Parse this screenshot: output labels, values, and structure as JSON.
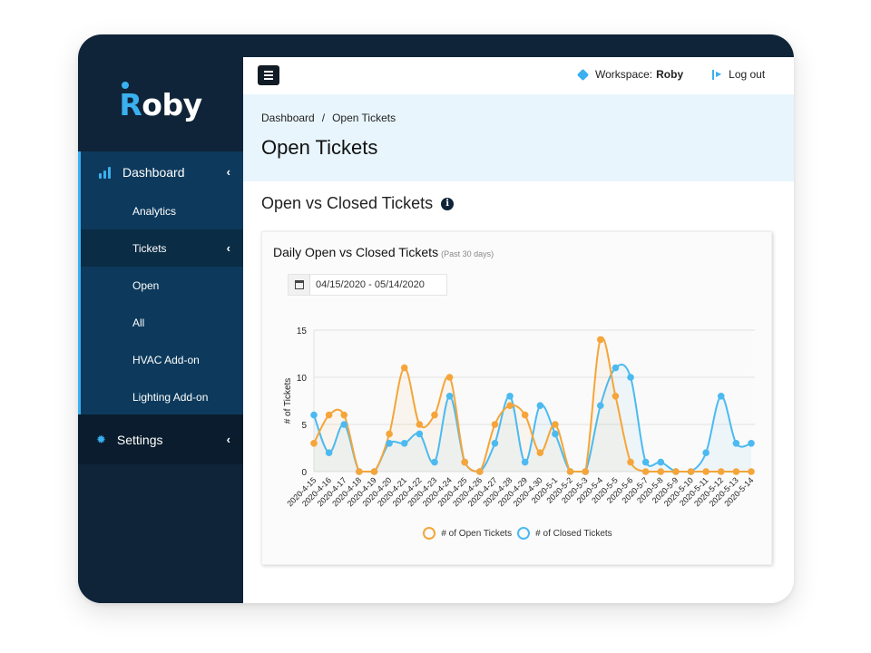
{
  "app": {
    "logo_text_r": "R",
    "logo_text_rest": "oby"
  },
  "sidebar": {
    "items": [
      {
        "label": "Dashboard",
        "icon": "bar-chart-icon",
        "expanded": true
      },
      {
        "label": "Analytics"
      },
      {
        "label": "Tickets",
        "active": true
      },
      {
        "label": "Open"
      },
      {
        "label": "All"
      },
      {
        "label": "HVAC Add-on"
      },
      {
        "label": "Lighting Add-on"
      },
      {
        "label": "Settings",
        "icon": "gear-icon"
      }
    ],
    "chevron": "‹"
  },
  "topnav": {
    "menu_icon": "hamburger-icon",
    "workspace_label": "Workspace:",
    "workspace_name": "Roby",
    "logout_label": "Log out"
  },
  "header": {
    "breadcrumb": [
      "Dashboard",
      "Open Tickets"
    ],
    "breadcrumb_sep": "/",
    "title": "Open Tickets"
  },
  "section": {
    "title": "Open vs Closed Tickets",
    "info_icon": "i"
  },
  "card": {
    "title": "Daily Open vs Closed Tickets",
    "subtitle": "(Past 30 days)",
    "date_range": "04/15/2020 - 05/14/2020"
  },
  "colors": {
    "open": "#f5a53a",
    "closed": "#4cbaf0",
    "accent": "#3ab0f0",
    "sidebar": "#0f2438"
  },
  "chart_data": {
    "type": "line",
    "title": "Daily Open vs Closed Tickets",
    "xlabel": "",
    "ylabel": "# of Tickets",
    "ylim": [
      0,
      15
    ],
    "yticks": [
      0,
      5,
      10,
      15
    ],
    "grid": true,
    "smooth": true,
    "legend": "bottom",
    "x": [
      "2020-4-15",
      "2020-4-16",
      "2020-4-17",
      "2020-4-18",
      "2020-4-19",
      "2020-4-20",
      "2020-4-21",
      "2020-4-22",
      "2020-4-23",
      "2020-4-24",
      "2020-4-25",
      "2020-4-26",
      "2020-4-27",
      "2020-4-28",
      "2020-4-29",
      "2020-4-30",
      "2020-5-1",
      "2020-5-2",
      "2020-5-3",
      "2020-5-4",
      "2020-5-5",
      "2020-5-6",
      "2020-5-7",
      "2020-5-8",
      "2020-5-9",
      "2020-5-10",
      "2020-5-11",
      "2020-5-12",
      "2020-5-13",
      "2020-5-14"
    ],
    "series": [
      {
        "name": "# of Open Tickets",
        "color": "#f5a53a",
        "values": [
          3,
          6,
          6,
          0,
          0,
          4,
          11,
          5,
          6,
          10,
          1,
          0,
          5,
          7,
          6,
          2,
          5,
          0,
          0,
          14,
          8,
          1,
          0,
          0,
          0,
          0,
          0,
          0,
          0,
          0
        ]
      },
      {
        "name": "# of Closed Tickets",
        "color": "#4cbaf0",
        "values": [
          6,
          2,
          5,
          0,
          0,
          3,
          3,
          4,
          1,
          8,
          1,
          0,
          3,
          8,
          1,
          7,
          4,
          0,
          0,
          7,
          11,
          10,
          1,
          1,
          0,
          0,
          2,
          8,
          3,
          3
        ]
      }
    ]
  }
}
